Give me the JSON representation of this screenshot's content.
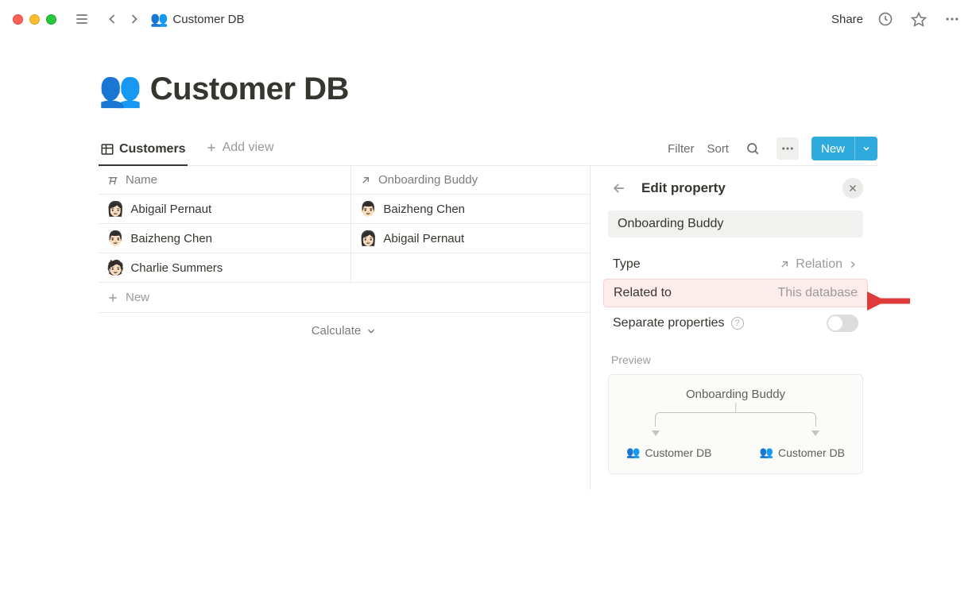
{
  "window": {
    "breadcrumb_icon": "👥",
    "breadcrumb_title": "Customer DB",
    "share": "Share"
  },
  "page": {
    "icon": "👥",
    "title": "Customer DB"
  },
  "views": {
    "active_tab": "Customers",
    "add_view": "Add view",
    "filter": "Filter",
    "sort": "Sort",
    "new_button": "New"
  },
  "table": {
    "columns": {
      "name": "Name",
      "buddy": "Onboarding Buddy"
    },
    "rows": [
      {
        "name": "Abigail Pernaut",
        "buddy": "Baizheng Chen"
      },
      {
        "name": "Baizheng Chen",
        "buddy": "Abigail Pernaut"
      },
      {
        "name": "Charlie Summers",
        "buddy": ""
      }
    ],
    "new_row": "New",
    "calculate": "Calculate"
  },
  "panel": {
    "title": "Edit property",
    "name_value": "Onboarding Buddy",
    "rows": {
      "type_label": "Type",
      "type_value": "Relation",
      "related_label": "Related to",
      "related_value": "This database",
      "separate_label": "Separate properties"
    },
    "preview": {
      "label": "Preview",
      "title": "Onboarding Buddy",
      "db1": "Customer DB",
      "db2": "Customer DB"
    }
  }
}
